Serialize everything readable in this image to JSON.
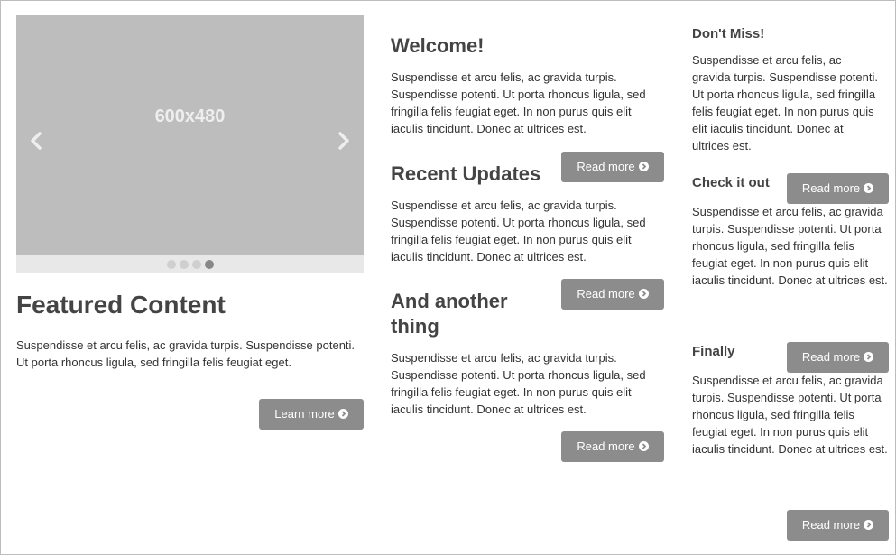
{
  "carousel": {
    "placeholder_label": "600x480",
    "prev_icon": "chevron-left-icon",
    "next_icon": "chevron-right-icon",
    "slide_count": 4,
    "active_index": 3
  },
  "featured": {
    "title": "Featured Content",
    "text": "Suspendisse et arcu felis, ac gravida turpis. Suspendisse potenti. Ut porta rhoncus ligula, sed fringilla felis feugiat eget.",
    "button": "Learn more"
  },
  "middle": [
    {
      "title": "Welcome!",
      "text": "Suspendisse et arcu felis, ac gravida turpis. Suspendisse potenti. Ut porta rhoncus ligula, sed fringilla felis feugiat eget. In non purus quis elit iaculis tincidunt. Donec at ultrices est.",
      "button": "Read more"
    },
    {
      "title": "Recent Updates",
      "text": "Suspendisse et arcu felis, ac gravida turpis. Suspendisse potenti. Ut porta rhoncus ligula, sed fringilla felis feugiat eget. In non purus quis elit iaculis tincidunt. Donec at ultrices est.",
      "button": "Read more"
    },
    {
      "title": "And another thing",
      "text": "Suspendisse et arcu felis, ac gravida turpis. Suspendisse potenti. Ut porta rhoncus ligula, sed fringilla felis feugiat eget. In non purus quis elit iaculis tincidunt. Donec at ultrices est.",
      "button": "Read more"
    }
  ],
  "right": [
    {
      "title": "Don't Miss!",
      "text": "Suspendisse et arcu felis, ac gravida turpis. Suspendisse potenti. Ut porta rhoncus ligula, sed fringilla felis feugiat eget. In non purus quis elit iaculis tincidunt. Donec at ultrices est."
    },
    {
      "title": "Check it out",
      "text": "Suspendisse et arcu felis, ac gravida turpis. Suspendisse potenti. Ut porta rhoncus ligula, sed fringilla felis feugiat eget. In non purus quis elit iaculis tincidunt. Donec at ultrices est.",
      "button": "Read more"
    },
    {
      "title": "Finally",
      "text": "Suspendisse et arcu felis, ac gravida turpis. Suspendisse potenti. Ut porta rhoncus ligula, sed fringilla felis feugiat eget. In non purus quis elit iaculis tincidunt. Donec at ultrices est.",
      "button": "Read more"
    }
  ],
  "bottom_button": "Read more",
  "button_icon": "arrow-circle-right-icon",
  "colors": {
    "button_bg": "#8c8c8c",
    "carousel_bg": "#bdbdbd",
    "indicator_bar": "#e8e8e8"
  }
}
